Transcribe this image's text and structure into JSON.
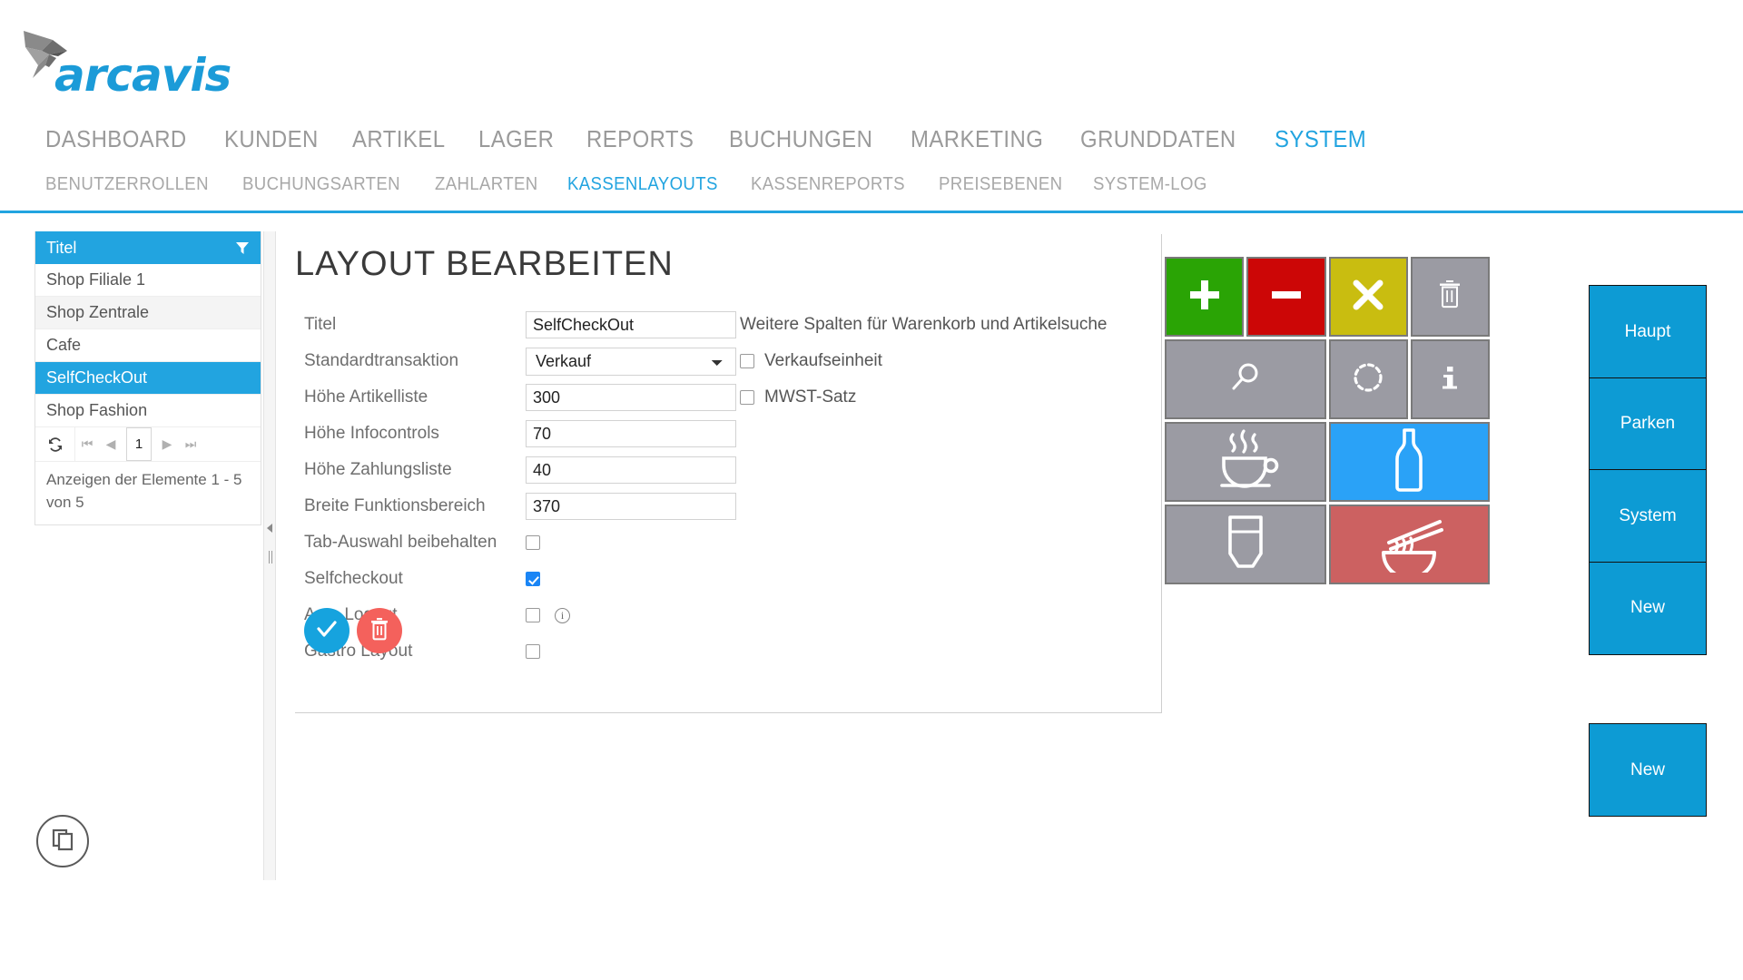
{
  "brand": {
    "name": "arcavis",
    "color": "#1B9BD8",
    "logo_icon": "bird-logo"
  },
  "main_nav": {
    "items": [
      {
        "label": "DASHBOARD",
        "active": false
      },
      {
        "label": "KUNDEN",
        "active": false
      },
      {
        "label": "ARTIKEL",
        "active": false
      },
      {
        "label": "LAGER",
        "active": false
      },
      {
        "label": "REPORTS",
        "active": false
      },
      {
        "label": "BUCHUNGEN",
        "active": false
      },
      {
        "label": "MARKETING",
        "active": false
      },
      {
        "label": "GRUNDDATEN",
        "active": false
      },
      {
        "label": "SYSTEM",
        "active": true
      }
    ]
  },
  "sub_nav": {
    "items": [
      {
        "label": "BENUTZERROLLEN",
        "active": false
      },
      {
        "label": "BUCHUNGSARTEN",
        "active": false
      },
      {
        "label": "ZAHLARTEN",
        "active": false
      },
      {
        "label": "KASSENLAYOUTS",
        "active": true
      },
      {
        "label": "KASSENREPORTS",
        "active": false
      },
      {
        "label": "PREISEBENEN",
        "active": false
      },
      {
        "label": "SYSTEM-LOG",
        "active": false
      }
    ]
  },
  "sidebar": {
    "header": "Titel",
    "filter_icon": "filter-funnel-icon",
    "rows": [
      {
        "label": "Shop Filiale 1",
        "selected": false
      },
      {
        "label": "Shop Zentrale",
        "selected": false
      },
      {
        "label": "Cafe",
        "selected": false
      },
      {
        "label": "SelfCheckOut",
        "selected": true
      },
      {
        "label": "Shop Fashion",
        "selected": false
      }
    ],
    "pager": {
      "refresh_icon": "refresh-icon",
      "first_label": "⏮",
      "prev_label": "◀",
      "page": "1",
      "next_label": "▶",
      "last_label": "⏭"
    },
    "status": "Anzeigen der Elemente 1 - 5 von 5"
  },
  "panel": {
    "title": "LAYOUT BEARBEITEN",
    "fields": [
      {
        "label": "Titel",
        "type": "text",
        "value": "SelfCheckOut"
      },
      {
        "label": "Standardtransaktion",
        "type": "select",
        "value": "Verkauf",
        "options": [
          "Verkauf"
        ]
      },
      {
        "label": "Höhe Artikelliste",
        "type": "text",
        "value": "300"
      },
      {
        "label": "Höhe Infocontrols",
        "type": "text",
        "value": "70"
      },
      {
        "label": "Höhe Zahlungsliste",
        "type": "text",
        "value": "40"
      },
      {
        "label": "Breite Funktionsbereich",
        "type": "text",
        "value": "370"
      },
      {
        "label": "Tab-Auswahl beibehalten",
        "type": "checkbox",
        "checked": false
      },
      {
        "label": "Selfcheckout",
        "type": "checkbox",
        "checked": true
      },
      {
        "label": "Auto Logout",
        "type": "checkbox",
        "checked": false,
        "info": true
      },
      {
        "label": "Gastro Layout",
        "type": "checkbox",
        "checked": false
      }
    ],
    "right_column": {
      "title": "Weitere Spalten für Warenkorb und Artikelsuche",
      "checks": [
        {
          "label": "Verkaufseinheit",
          "checked": false
        },
        {
          "label": "MWST-Satz",
          "checked": false
        }
      ]
    },
    "actions": {
      "save_icon": "checkmark-icon",
      "save_color": "#16A3DE",
      "delete_icon": "trash-icon",
      "delete_color": "#F4615C"
    }
  },
  "pos_preview": {
    "buttons": [
      {
        "icon": "plus-icon",
        "color": "#2AA405",
        "style": "green",
        "span": 1
      },
      {
        "icon": "minus-icon",
        "color": "#CC0606",
        "style": "red",
        "span": 1
      },
      {
        "icon": "close-x-icon",
        "color": "#C9BD10",
        "style": "olive",
        "span": 1
      },
      {
        "icon": "trash-icon",
        "color": "#9B9BA3",
        "style": "gray",
        "span": 1
      },
      {
        "icon": "search-icon",
        "color": "#9B9BA3",
        "style": "gray",
        "span": 2
      },
      {
        "icon": "dotted-circle-icon",
        "color": "#9B9BA3",
        "style": "gray",
        "span": 1
      },
      {
        "icon": "info-icon",
        "color": "#9B9BA3",
        "style": "gray",
        "span": 1
      },
      {
        "icon": "coffee-cup-icon",
        "color": "#9B9BA3",
        "style": "gray",
        "span": 2
      },
      {
        "icon": "bottle-icon",
        "color": "#2AA2F7",
        "style": "blue",
        "span": 2
      },
      {
        "icon": "glass-icon",
        "color": "#9B9BA3",
        "style": "gray",
        "span": 2
      },
      {
        "icon": "noodle-bowl-icon",
        "color": "#CC6161",
        "style": "salmon",
        "span": 2
      }
    ]
  },
  "tab_column": {
    "color": "#0D9BD4",
    "tabs": [
      {
        "label": "Haupt"
      },
      {
        "label": "Parken"
      },
      {
        "label": "System"
      },
      {
        "label": "New"
      }
    ],
    "extra": {
      "label": "New"
    }
  },
  "footer": {
    "copy_icon": "copy-icon"
  }
}
